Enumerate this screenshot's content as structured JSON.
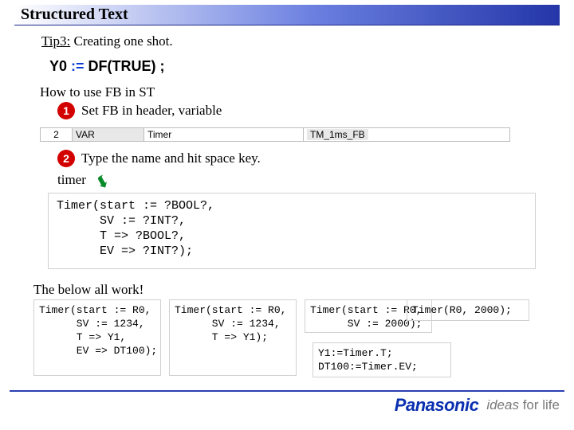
{
  "title": "Structured Text",
  "tip": {
    "label": "Tip3:",
    "text": " Creating one shot."
  },
  "code_top": {
    "lhs": "Y0",
    "op": " := ",
    "rhs": "DF(TRUE) ;"
  },
  "howto_heading": "How to use FB in ST",
  "step1": {
    "num": "1",
    "text": "Set FB in header, variable"
  },
  "var_row": {
    "num": "2",
    "class": "VAR",
    "ident": "Timer",
    "type": "TM_1ms_FB"
  },
  "step2": {
    "num": "2",
    "text": "Type the name and hit space key.",
    "typed": "timer"
  },
  "call_template": {
    "l1": "Timer(start := ?BOOL?,",
    "l2": "      SV := ?INT?,",
    "l3": "      T => ?BOOL?,",
    "l4": "      EV => ?INT?);"
  },
  "works_label": "The below all work!",
  "ex1": {
    "l1": "Timer(start := R0,",
    "l2": "      SV := 1234,",
    "l3": "      T => Y1,",
    "l4": "      EV => DT100);"
  },
  "ex2": {
    "l1": "Timer(start := R0,",
    "l2": "      SV := 1234,",
    "l3": "      T => Y1);"
  },
  "ex3_top": {
    "l1": "Timer(start := R0,",
    "l2": "      SV := 2000);"
  },
  "ex3_bot": {
    "l1": "Y1:=Timer.T;",
    "l2": "DT100:=Timer.EV;"
  },
  "ex4": {
    "l1": "Timer(R0, 2000);"
  },
  "brand": {
    "name": "Panasonic",
    "tagline_em": "ideas",
    "tagline_rest": " for life"
  }
}
